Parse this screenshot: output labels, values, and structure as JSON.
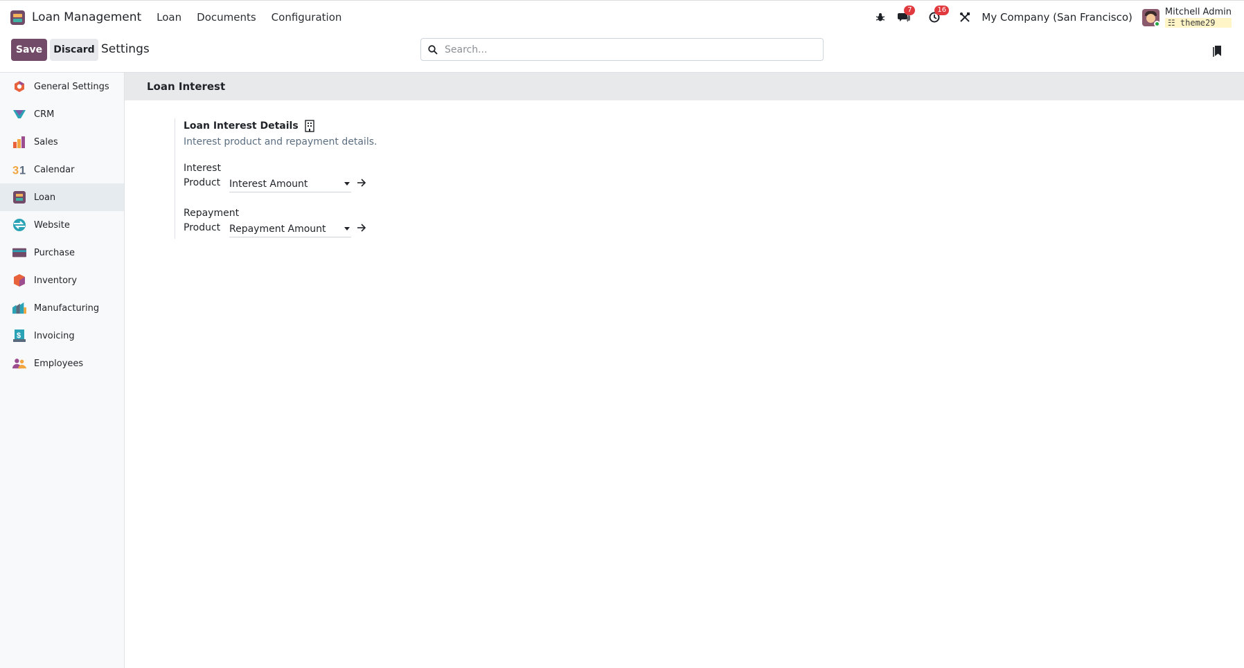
{
  "navbar": {
    "app_name": "Loan Management",
    "menus": [
      "Loan",
      "Documents",
      "Configuration"
    ],
    "messages_count": "7",
    "activities_count": "16",
    "company": "My Company (San Francisco)",
    "user_name": "Mitchell Admin",
    "database": "theme29"
  },
  "control_panel": {
    "save_label": "Save",
    "discard_label": "Discard",
    "title": "Settings",
    "search_placeholder": "Search..."
  },
  "sidebar": {
    "items": [
      {
        "label": "General Settings",
        "icon": "general-settings-icon"
      },
      {
        "label": "CRM",
        "icon": "crm-icon"
      },
      {
        "label": "Sales",
        "icon": "sales-icon"
      },
      {
        "label": "Calendar",
        "icon": "calendar-icon"
      },
      {
        "label": "Loan",
        "icon": "loan-icon",
        "active": true
      },
      {
        "label": "Website",
        "icon": "website-icon"
      },
      {
        "label": "Purchase",
        "icon": "purchase-icon"
      },
      {
        "label": "Inventory",
        "icon": "inventory-icon"
      },
      {
        "label": "Manufacturing",
        "icon": "manufacturing-icon"
      },
      {
        "label": "Invoicing",
        "icon": "invoicing-icon"
      },
      {
        "label": "Employees",
        "icon": "employees-icon"
      }
    ]
  },
  "main": {
    "section_title": "Loan Interest",
    "setting": {
      "title": "Loan Interest Details",
      "description": "Interest product and repayment details.",
      "interest": {
        "label_line1": "Interest",
        "label_line2": "Product",
        "value": "Interest Amount"
      },
      "repayment": {
        "label_line1": "Repayment",
        "label_line2": "Product",
        "value": "Repayment Amount"
      }
    }
  },
  "colors": {
    "brand": "#714b67",
    "badge": "#e0393e",
    "sidebar_bg": "#f8f9fa",
    "section_bg": "#e8e9eb"
  }
}
